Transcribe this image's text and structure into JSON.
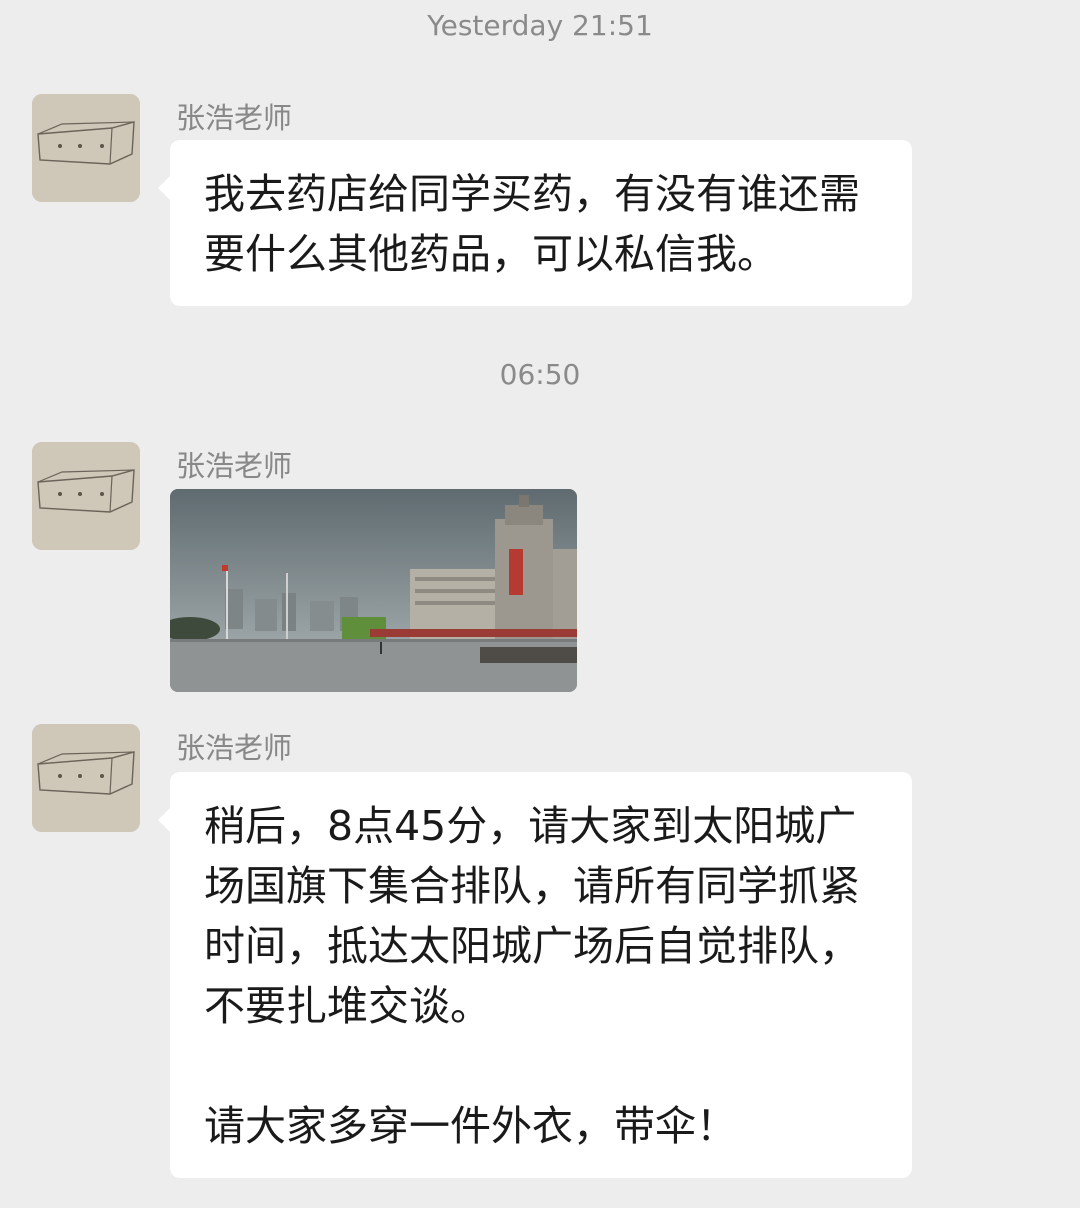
{
  "chat": {
    "messages": [
      {
        "time": "Yesterday  21:51",
        "sender": "张浩老师",
        "text": "我去药店给同学买药，有没有谁还需要什么其他药品，可以私信我。"
      },
      {
        "time": "06:50",
        "sender": "张浩老师",
        "image_alt": "photo"
      },
      {
        "sender": "张浩老师",
        "text": "稍后，8点45分，请大家到太阳城广场国旗下集合排队，请所有同学抓紧时间，抵达太阳城广场后自觉排队，不要扎堆交谈。\n\n请大家多穿一件外衣，带伞！"
      }
    ]
  }
}
